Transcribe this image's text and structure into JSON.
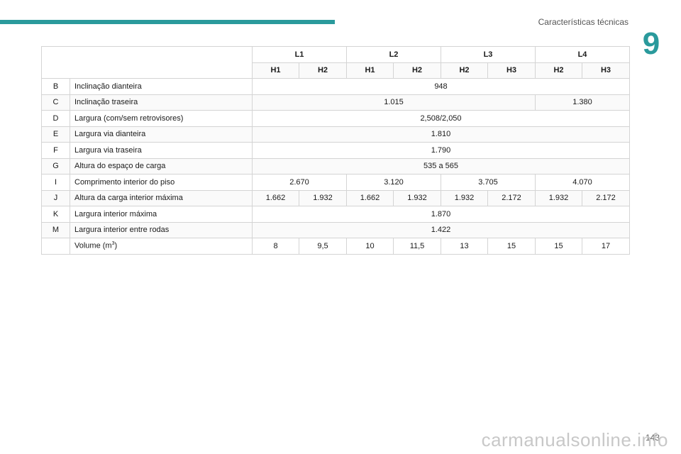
{
  "header": {
    "section_title": "Características técnicas",
    "chapter_number": "9"
  },
  "table": {
    "length_headers": [
      "L1",
      "L2",
      "L3",
      "L4"
    ],
    "height_headers": [
      "H1",
      "H2",
      "H1",
      "H2",
      "H2",
      "H3",
      "H2",
      "H3"
    ],
    "rows": [
      {
        "code": "B",
        "label": "Inclinação dianteira",
        "values": [
          "948"
        ]
      },
      {
        "code": "C",
        "label": "Inclinação traseira",
        "values": [
          "1.015",
          "1.380"
        ]
      },
      {
        "code": "D",
        "label": "Largura (com/sem retrovisores)",
        "values": [
          "2,508/2,050"
        ]
      },
      {
        "code": "E",
        "label": "Largura via dianteira",
        "values": [
          "1.810"
        ]
      },
      {
        "code": "F",
        "label": "Largura via traseira",
        "values": [
          "1.790"
        ]
      },
      {
        "code": "G",
        "label": "Altura do espaço de carga",
        "values": [
          "535 a 565"
        ]
      },
      {
        "code": "I",
        "label": "Comprimento interior do piso",
        "values": [
          "2.670",
          "3.120",
          "3.705",
          "4.070"
        ]
      },
      {
        "code": "J",
        "label": "Altura da carga interior máxima",
        "values": [
          "1.662",
          "1.932",
          "1.662",
          "1.932",
          "1.932",
          "2.172",
          "1.932",
          "2.172"
        ]
      },
      {
        "code": "K",
        "label": "Largura interior máxima",
        "values": [
          "1.870"
        ]
      },
      {
        "code": "M",
        "label": "Largura interior entre rodas",
        "values": [
          "1.422"
        ]
      },
      {
        "code": "",
        "label": "Volume (m",
        "label_sup": "3",
        "label_suffix": ")",
        "values": [
          "8",
          "9,5",
          "10",
          "11,5",
          "13",
          "15",
          "15",
          "17"
        ]
      }
    ]
  },
  "footer": {
    "page_number": "143",
    "watermark": "carmanualsonline.info"
  }
}
